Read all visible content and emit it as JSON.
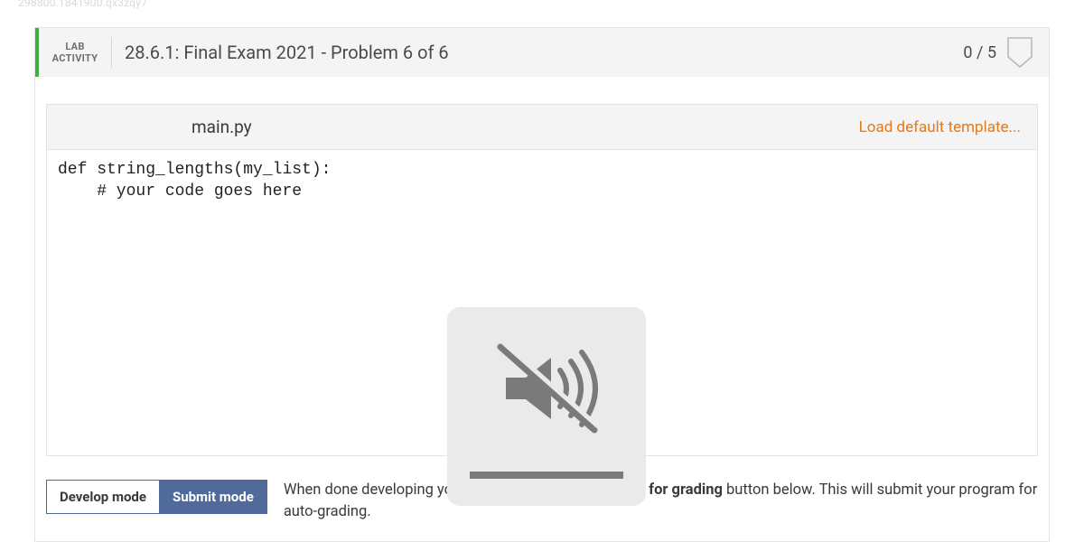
{
  "watermark": "298800.1841900.qx3zqy7",
  "header": {
    "badge_line1": "LAB",
    "badge_line2": "ACTIVITY",
    "title": "28.6.1: Final Exam 2021 - Problem 6 of 6",
    "score": "0 / 5"
  },
  "editor": {
    "filename": "main.py",
    "load_template_label": "Load default template...",
    "code": "def string_lengths(my_list):\n    # your code goes here"
  },
  "modes": {
    "develop_label": "Develop mode",
    "submit_label": "Submit mode",
    "help_prefix": "When done developing your program, press the ",
    "help_bold": "Submit for grading",
    "help_suffix": " button below. This will submit your program for auto-grading."
  }
}
